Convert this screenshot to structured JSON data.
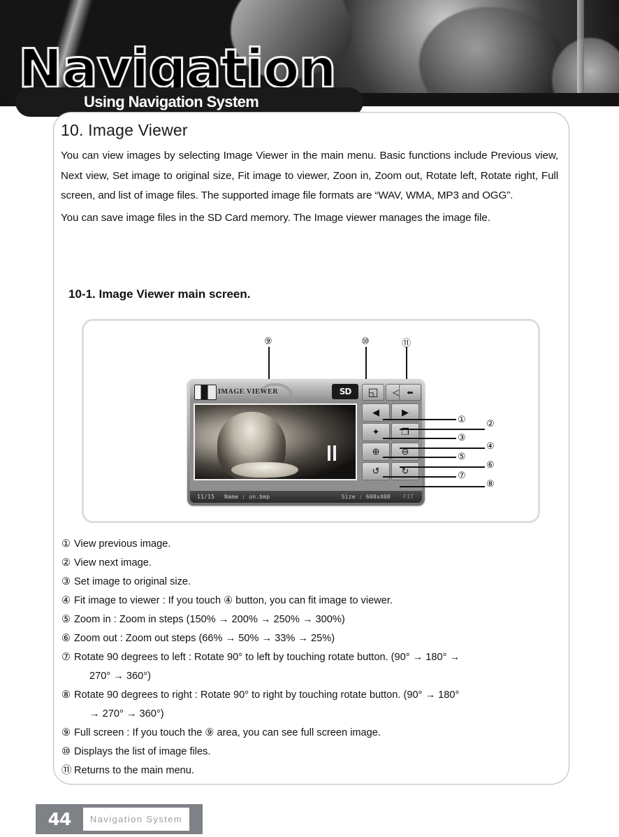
{
  "banner": {
    "wordmark": "Navigation",
    "pill_title": "Using Navigation System"
  },
  "section": {
    "title": "10. Image Viewer",
    "paragraph1": "You can view images by selecting Image Viewer in the main menu. Basic functions include Previous view, Next view, Set image to original size, Fit image to viewer, Zoon in, Zoom out, Rotate left, Rotate right, Full screen, and list of image files. The supported image file formats are “WAV, WMA, MP3 and OGG”.",
    "paragraph2": "You can save image files in the SD Card memory. The Image viewer manages the image file.",
    "subsection_title": "10-1. Image Viewer main screen."
  },
  "diagram": {
    "top_callouts": [
      {
        "label": "⑨",
        "target": "full-screen-area"
      },
      {
        "label": "⑩",
        "target": "file-list-button"
      },
      {
        "label": "⑪",
        "target": "return-main-menu-button"
      }
    ],
    "side_callouts": [
      "①",
      "②",
      "③",
      "④",
      "⑤",
      "⑥",
      "⑦",
      "⑧"
    ],
    "device": {
      "title": "IMAGE VIEWER",
      "header_buttons": [
        {
          "name": "sd-card-indicator",
          "glyph": "SD"
        },
        {
          "name": "file-list-button",
          "glyph": "◱"
        },
        {
          "name": "volume-button",
          "glyph": "◁"
        },
        {
          "name": "back-button",
          "glyph": "⬅"
        }
      ],
      "control_buttons": [
        {
          "name": "previous-image-button",
          "glyph": "◀"
        },
        {
          "name": "next-image-button",
          "glyph": "▶"
        },
        {
          "name": "original-size-button",
          "glyph": "✦"
        },
        {
          "name": "fit-to-viewer-button",
          "glyph": "❐"
        },
        {
          "name": "zoom-in-button",
          "glyph": "⊕"
        },
        {
          "name": "zoom-out-button",
          "glyph": "⊖"
        },
        {
          "name": "rotate-left-button",
          "glyph": "↺"
        },
        {
          "name": "rotate-right-button",
          "glyph": "↻"
        }
      ],
      "status": {
        "index": "11/15",
        "name": "Name : un.bmp",
        "size": "Size : 600x400",
        "mode": "FIT"
      }
    }
  },
  "notes": [
    {
      "marker": "①",
      "text": "View previous image.",
      "cont": ""
    },
    {
      "marker": "②",
      "text": "View next image.",
      "cont": ""
    },
    {
      "marker": "③",
      "text": "Set image to original size.",
      "cont": ""
    },
    {
      "marker": "④",
      "text": "Fit image to viewer : If you touch ④ button, you can fit image to viewer.",
      "cont": ""
    },
    {
      "marker": "⑤",
      "text": "Zoom in : Zoom in steps (150% → 200% → 250% → 300%)",
      "cont": ""
    },
    {
      "marker": "⑥",
      "text": "Zoom out : Zoom out steps (66% → 50% → 33% → 25%)",
      "cont": ""
    },
    {
      "marker": "⑦",
      "text": "Rotate 90 degrees to left : Rotate 90° to left by touching rotate button. (90° → 180° →",
      "cont": "270° → 360°)"
    },
    {
      "marker": "⑧",
      "text": "Rotate 90 degrees to right : Rotate 90° to right by touching rotate button. (90° → 180°",
      "cont": "→ 270° → 360°)"
    },
    {
      "marker": "⑨",
      "text": "Full screen : If you touch the ⑨ area, you can see full screen image.",
      "cont": ""
    },
    {
      "marker": "⑩",
      "text": "Displays the list of image files.",
      "cont": ""
    },
    {
      "marker": "⑪",
      "text": "Returns to the main menu.",
      "cont": ""
    }
  ],
  "footer": {
    "page_number": "44",
    "label": "Navigation System"
  }
}
